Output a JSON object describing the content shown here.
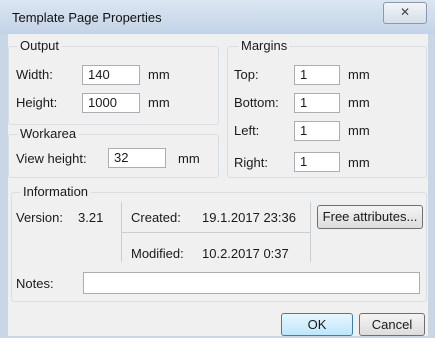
{
  "window": {
    "title": "Template Page Properties",
    "close_glyph": "✕"
  },
  "output": {
    "legend": "Output",
    "width_label": "Width:",
    "width_value": "140",
    "width_unit": "mm",
    "height_label": "Height:",
    "height_value": "1000",
    "height_unit": "mm"
  },
  "workarea": {
    "legend": "Workarea",
    "view_height_label": "View height:",
    "view_height_value": "32",
    "view_height_unit": "mm"
  },
  "margins": {
    "legend": "Margins",
    "top_label": "Top:",
    "top_value": "1",
    "top_unit": "mm",
    "bottom_label": "Bottom:",
    "bottom_value": "1",
    "bottom_unit": "mm",
    "left_label": "Left:",
    "left_value": "1",
    "left_unit": "mm",
    "right_label": "Right:",
    "right_value": "1",
    "right_unit": "mm"
  },
  "information": {
    "legend": "Information",
    "version_label": "Version:",
    "version_value": "3.21",
    "created_label": "Created:",
    "created_value": "19.1.2017 23:36",
    "modified_label": "Modified:",
    "modified_value": "10.2.2017 0:37",
    "free_attributes_label": "Free attributes...",
    "notes_label": "Notes:",
    "notes_value": ""
  },
  "buttons": {
    "ok_label": "OK",
    "cancel_label": "Cancel"
  }
}
